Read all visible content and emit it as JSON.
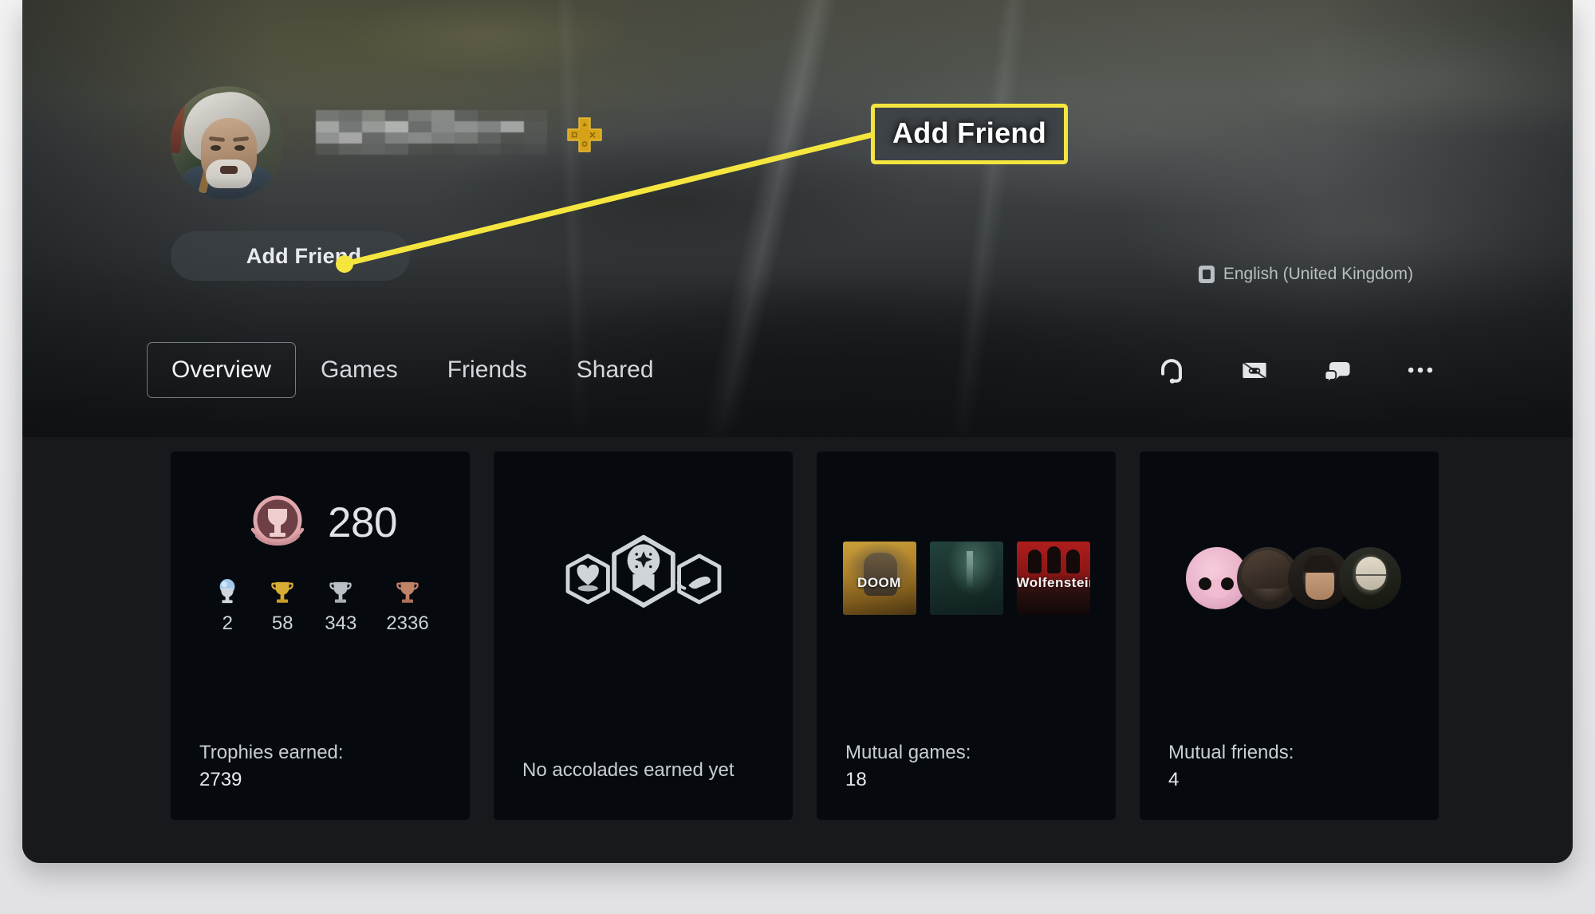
{
  "profile": {
    "username_censored": true,
    "avatar_name": "geralt-avatar",
    "ps_plus_badge": "playstation-plus-icon",
    "add_friend_label": "Add Friend",
    "language_label": "English (United Kingdom)",
    "language_icon": "language-icon"
  },
  "tabs": [
    {
      "label": "Overview",
      "active": true
    },
    {
      "label": "Games",
      "active": false
    },
    {
      "label": "Friends",
      "active": false
    },
    {
      "label": "Shared",
      "active": false
    }
  ],
  "tab_actions": [
    {
      "icon": "headset-icon"
    },
    {
      "icon": "game-card-icon"
    },
    {
      "icon": "chat-bubbles-icon"
    },
    {
      "icon": "more-options-icon"
    }
  ],
  "cards": {
    "trophies": {
      "level": "280",
      "breakdown": [
        {
          "type": "platinum",
          "count": "2"
        },
        {
          "type": "gold",
          "count": "58"
        },
        {
          "type": "silver",
          "count": "343"
        },
        {
          "type": "bronze",
          "count": "2336"
        }
      ],
      "footer_label": "Trophies earned:",
      "footer_value": "2739"
    },
    "accolades": {
      "icons": [
        "heart-hexagon-icon",
        "award-hexagon-icon",
        "helping-hand-hexagon-icon"
      ],
      "empty_message": "No accolades earned yet"
    },
    "mutual_games": {
      "covers": [
        "DOOM",
        "",
        "Wolfenstein"
      ],
      "footer_label": "Mutual games:",
      "footer_value": "18"
    },
    "mutual_friends": {
      "avatars": [
        "pig-avatar",
        "warrior-avatar",
        "man-avatar",
        "old-man-avatar"
      ],
      "footer_label": "Mutual friends:",
      "footer_value": "4"
    }
  },
  "annotation": {
    "callout_label": "Add Friend",
    "highlight_color": "#F5E53F"
  }
}
